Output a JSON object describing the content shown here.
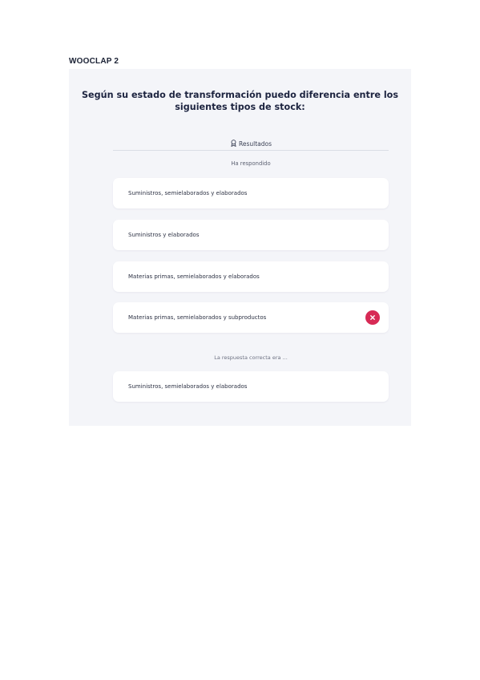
{
  "document": {
    "label": "WOOCLAP 2"
  },
  "quiz": {
    "question": "Según su estado de transformación puedo diferencia entre los siguientes tipos de stock:",
    "results_label": "Resultados",
    "answered_label": "Ha respondido",
    "options": [
      {
        "text": "Suministros, semielaborados y elaborados"
      },
      {
        "text": "Suministros y elaborados"
      },
      {
        "text": "Materias primas, semielaborados y elaborados"
      },
      {
        "text": "Materias primas, semielaborados y subproductos",
        "status": "incorrect"
      }
    ],
    "correct_answer_label": "La respuesta correcta era ...",
    "correct_answer": {
      "text": "Suministros, semielaborados y elaborados"
    }
  },
  "colors": {
    "panel_bg": "#f4f5f9",
    "card_bg": "#ffffff",
    "incorrect_badge": "#d72a55",
    "question_text": "#1d2440"
  },
  "icons": {
    "results": "podium-icon",
    "incorrect": "close-icon"
  }
}
